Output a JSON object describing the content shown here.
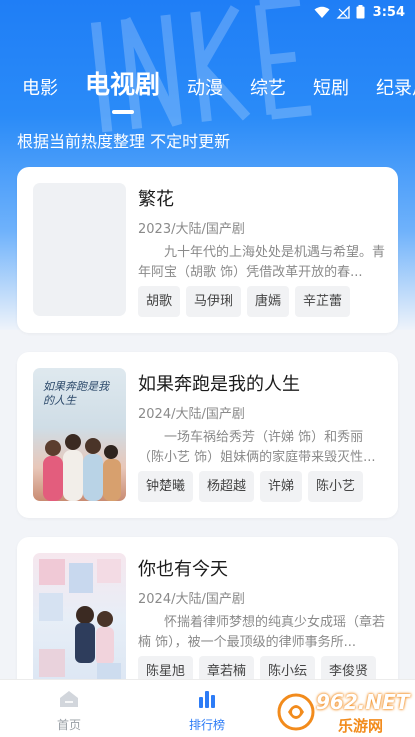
{
  "status_bar": {
    "time": "3:54"
  },
  "tabs": [
    {
      "label": "电影",
      "active": false
    },
    {
      "label": "电视剧",
      "active": true
    },
    {
      "label": "动漫",
      "active": false
    },
    {
      "label": "综艺",
      "active": false
    },
    {
      "label": "短剧",
      "active": false
    },
    {
      "label": "纪录片",
      "active": false
    }
  ],
  "subtitle": "根据当前热度整理 不定时更新",
  "cards": [
    {
      "title": "繁花",
      "meta": "2023/大陆/国产剧",
      "description": "九十年代的上海处处是机遇与希望。青年阿宝（胡歌 饰）凭借改革开放的春...",
      "cast": [
        "胡歌",
        "马伊琍",
        "唐嫣",
        "辛芷蕾"
      ]
    },
    {
      "title": "如果奔跑是我的人生",
      "meta": "2024/大陆/国产剧",
      "description": "一场车祸给秀芳（许娣 饰）和秀丽（陈小艺 饰）姐妹俩的家庭带来毁灭性...",
      "cast": [
        "钟楚曦",
        "杨超越",
        "许娣",
        "陈小艺"
      ],
      "poster_text": "如果奔跑是我的人生"
    },
    {
      "title": "你也有今天",
      "meta": "2024/大陆/国产剧",
      "description": "怀揣着律师梦想的纯真少女成瑶（章若楠 饰），被一个最顶级的律师事务所...",
      "cast": [
        "陈星旭",
        "章若楠",
        "陈小纭",
        "李俊贤"
      ]
    }
  ],
  "bottom_nav": [
    {
      "label": "首页",
      "icon": "home-icon",
      "active": false
    },
    {
      "label": "排行榜",
      "icon": "ranking-icon",
      "active": true
    },
    {
      "label": "",
      "icon": "",
      "active": false
    }
  ],
  "watermark": {
    "text_main": "962.NET",
    "text_sub": "乐游网"
  },
  "colors": {
    "accent": "#2d7cf6",
    "hero_top": "#1f7ef6"
  }
}
